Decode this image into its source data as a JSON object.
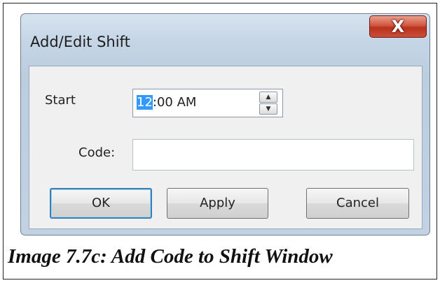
{
  "dialog": {
    "title": "Add/Edit Shift",
    "close_glyph": "X",
    "start_label": "Start",
    "start_value_selected": "12",
    "start_value_rest": ":00 AM",
    "spin_up_glyph": "▲",
    "spin_down_glyph": "▼",
    "code_label": "Code:",
    "code_value": "",
    "ok_label": "OK",
    "apply_label": "Apply",
    "cancel_label": "Cancel"
  },
  "caption": "Image 7.7c: Add Code to Shift Window",
  "colors": {
    "selection": "#3399ff",
    "close_button": "#c9503a",
    "title_bar": "#c5d5e6"
  },
  "icons": {
    "close": "close-icon",
    "spin_up": "spin-up-arrow-icon",
    "spin_down": "spin-down-arrow-icon"
  }
}
